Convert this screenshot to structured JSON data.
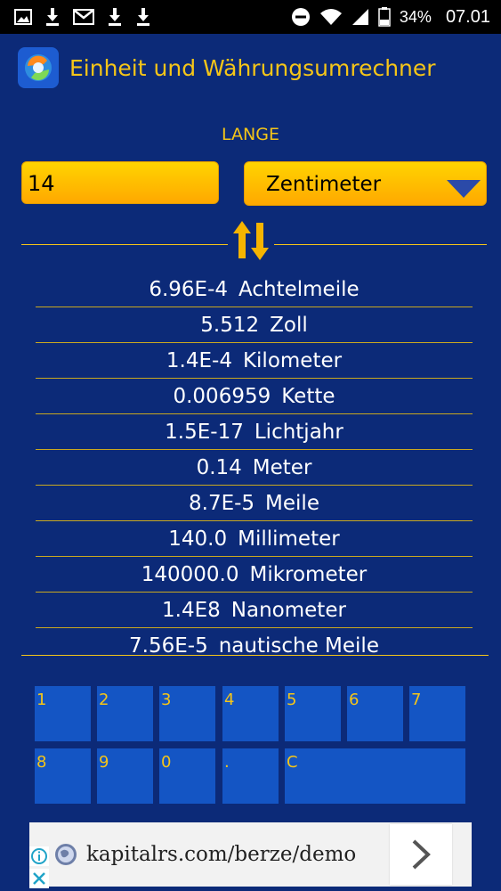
{
  "status_bar": {
    "battery": "34%",
    "time": "07.01",
    "icons": [
      "gallery-icon",
      "download-icon",
      "gmail-icon",
      "download-icon",
      "download-icon",
      "dnd-icon",
      "wifi-icon",
      "signal-icon",
      "battery-icon"
    ]
  },
  "header": {
    "title": "Einheit und Währungsumrechner"
  },
  "category": "LANGE",
  "input": {
    "value": "14"
  },
  "unit_select": {
    "value": "Zentimeter"
  },
  "results": [
    {
      "value": "6.96E-4",
      "unit": "Achtelmeile"
    },
    {
      "value": "5.512",
      "unit": "Zoll"
    },
    {
      "value": "1.4E-4",
      "unit": "Kilometer"
    },
    {
      "value": "0.006959",
      "unit": "Kette"
    },
    {
      "value": "1.5E-17",
      "unit": "Lichtjahr"
    },
    {
      "value": "0.14",
      "unit": "Meter"
    },
    {
      "value": "8.7E-5",
      "unit": "Meile"
    },
    {
      "value": "140.0",
      "unit": "Millimeter"
    },
    {
      "value": "140000.0",
      "unit": "Mikrometer"
    },
    {
      "value": "1.4E8",
      "unit": "Nanometer"
    },
    {
      "value": "7.56E-5",
      "unit": "nautische Meile"
    }
  ],
  "keypad": {
    "k1": "1",
    "k2": "2",
    "k3": "3",
    "k4": "4",
    "k5": "5",
    "k6": "6",
    "k7": "7",
    "k8": "8",
    "k9": "9",
    "k0": "0",
    "kdot": ".",
    "kc": "C"
  },
  "ad": {
    "url": "kapitalrs.com/berze/demo"
  },
  "colors": {
    "background": "#0c2a78",
    "accent": "#f5c518",
    "key": "#1455c4"
  }
}
